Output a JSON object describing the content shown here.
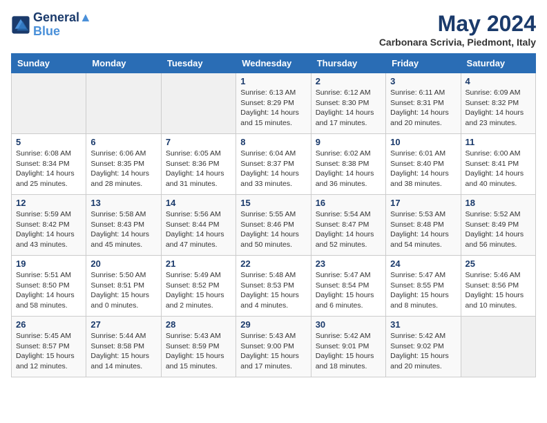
{
  "header": {
    "logo_line1": "General",
    "logo_line2": "Blue",
    "month": "May 2024",
    "location": "Carbonara Scrivia, Piedmont, Italy"
  },
  "days_of_week": [
    "Sunday",
    "Monday",
    "Tuesday",
    "Wednesday",
    "Thursday",
    "Friday",
    "Saturday"
  ],
  "weeks": [
    [
      {
        "day": "",
        "info": ""
      },
      {
        "day": "",
        "info": ""
      },
      {
        "day": "",
        "info": ""
      },
      {
        "day": "1",
        "info": "Sunrise: 6:13 AM\nSunset: 8:29 PM\nDaylight: 14 hours\nand 15 minutes."
      },
      {
        "day": "2",
        "info": "Sunrise: 6:12 AM\nSunset: 8:30 PM\nDaylight: 14 hours\nand 17 minutes."
      },
      {
        "day": "3",
        "info": "Sunrise: 6:11 AM\nSunset: 8:31 PM\nDaylight: 14 hours\nand 20 minutes."
      },
      {
        "day": "4",
        "info": "Sunrise: 6:09 AM\nSunset: 8:32 PM\nDaylight: 14 hours\nand 23 minutes."
      }
    ],
    [
      {
        "day": "5",
        "info": "Sunrise: 6:08 AM\nSunset: 8:34 PM\nDaylight: 14 hours\nand 25 minutes."
      },
      {
        "day": "6",
        "info": "Sunrise: 6:06 AM\nSunset: 8:35 PM\nDaylight: 14 hours\nand 28 minutes."
      },
      {
        "day": "7",
        "info": "Sunrise: 6:05 AM\nSunset: 8:36 PM\nDaylight: 14 hours\nand 31 minutes."
      },
      {
        "day": "8",
        "info": "Sunrise: 6:04 AM\nSunset: 8:37 PM\nDaylight: 14 hours\nand 33 minutes."
      },
      {
        "day": "9",
        "info": "Sunrise: 6:02 AM\nSunset: 8:38 PM\nDaylight: 14 hours\nand 36 minutes."
      },
      {
        "day": "10",
        "info": "Sunrise: 6:01 AM\nSunset: 8:40 PM\nDaylight: 14 hours\nand 38 minutes."
      },
      {
        "day": "11",
        "info": "Sunrise: 6:00 AM\nSunset: 8:41 PM\nDaylight: 14 hours\nand 40 minutes."
      }
    ],
    [
      {
        "day": "12",
        "info": "Sunrise: 5:59 AM\nSunset: 8:42 PM\nDaylight: 14 hours\nand 43 minutes."
      },
      {
        "day": "13",
        "info": "Sunrise: 5:58 AM\nSunset: 8:43 PM\nDaylight: 14 hours\nand 45 minutes."
      },
      {
        "day": "14",
        "info": "Sunrise: 5:56 AM\nSunset: 8:44 PM\nDaylight: 14 hours\nand 47 minutes."
      },
      {
        "day": "15",
        "info": "Sunrise: 5:55 AM\nSunset: 8:46 PM\nDaylight: 14 hours\nand 50 minutes."
      },
      {
        "day": "16",
        "info": "Sunrise: 5:54 AM\nSunset: 8:47 PM\nDaylight: 14 hours\nand 52 minutes."
      },
      {
        "day": "17",
        "info": "Sunrise: 5:53 AM\nSunset: 8:48 PM\nDaylight: 14 hours\nand 54 minutes."
      },
      {
        "day": "18",
        "info": "Sunrise: 5:52 AM\nSunset: 8:49 PM\nDaylight: 14 hours\nand 56 minutes."
      }
    ],
    [
      {
        "day": "19",
        "info": "Sunrise: 5:51 AM\nSunset: 8:50 PM\nDaylight: 14 hours\nand 58 minutes."
      },
      {
        "day": "20",
        "info": "Sunrise: 5:50 AM\nSunset: 8:51 PM\nDaylight: 15 hours\nand 0 minutes."
      },
      {
        "day": "21",
        "info": "Sunrise: 5:49 AM\nSunset: 8:52 PM\nDaylight: 15 hours\nand 2 minutes."
      },
      {
        "day": "22",
        "info": "Sunrise: 5:48 AM\nSunset: 8:53 PM\nDaylight: 15 hours\nand 4 minutes."
      },
      {
        "day": "23",
        "info": "Sunrise: 5:47 AM\nSunset: 8:54 PM\nDaylight: 15 hours\nand 6 minutes."
      },
      {
        "day": "24",
        "info": "Sunrise: 5:47 AM\nSunset: 8:55 PM\nDaylight: 15 hours\nand 8 minutes."
      },
      {
        "day": "25",
        "info": "Sunrise: 5:46 AM\nSunset: 8:56 PM\nDaylight: 15 hours\nand 10 minutes."
      }
    ],
    [
      {
        "day": "26",
        "info": "Sunrise: 5:45 AM\nSunset: 8:57 PM\nDaylight: 15 hours\nand 12 minutes."
      },
      {
        "day": "27",
        "info": "Sunrise: 5:44 AM\nSunset: 8:58 PM\nDaylight: 15 hours\nand 14 minutes."
      },
      {
        "day": "28",
        "info": "Sunrise: 5:43 AM\nSunset: 8:59 PM\nDaylight: 15 hours\nand 15 minutes."
      },
      {
        "day": "29",
        "info": "Sunrise: 5:43 AM\nSunset: 9:00 PM\nDaylight: 15 hours\nand 17 minutes."
      },
      {
        "day": "30",
        "info": "Sunrise: 5:42 AM\nSunset: 9:01 PM\nDaylight: 15 hours\nand 18 minutes."
      },
      {
        "day": "31",
        "info": "Sunrise: 5:42 AM\nSunset: 9:02 PM\nDaylight: 15 hours\nand 20 minutes."
      },
      {
        "day": "",
        "info": ""
      }
    ]
  ]
}
